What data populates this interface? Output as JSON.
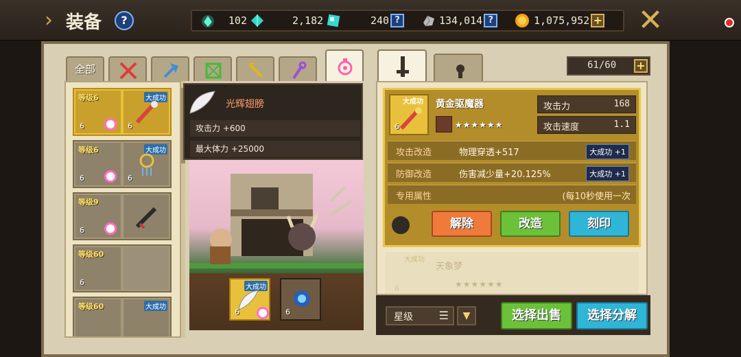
{
  "header": {
    "title": "装备",
    "help": "?",
    "resources": [
      {
        "name": "spirit-gem",
        "value": "102"
      },
      {
        "name": "crystal",
        "value": "2,182"
      },
      {
        "name": "blue-crystal",
        "value": "240",
        "badge": "?"
      },
      {
        "name": "iron-ore",
        "value": "134,014",
        "badge": "?"
      },
      {
        "name": "gold",
        "value": "1,075,952",
        "badge": "+"
      }
    ],
    "close": "✕"
  },
  "left_tabs": [
    {
      "label": "全部",
      "icon": "all"
    },
    {
      "label": "",
      "icon": "sword-icon"
    },
    {
      "label": "",
      "icon": "axe-icon"
    },
    {
      "label": "",
      "icon": "bow-icon"
    },
    {
      "label": "",
      "icon": "staff-icon"
    },
    {
      "label": "",
      "icon": "wand-icon"
    },
    {
      "label": "",
      "icon": "accessory-icon"
    }
  ],
  "equipment_list": [
    {
      "level": "等级6",
      "stars": "6",
      "tag": "大成功",
      "stars2": "6"
    },
    {
      "level": "等级6",
      "stars": "6",
      "tag": "大成功",
      "stars2": "6"
    },
    {
      "level": "等级9",
      "stars": "6",
      "tag": "",
      "stars2": ""
    },
    {
      "level": "等级60",
      "stars": "6",
      "tag": "",
      "stars2": ""
    },
    {
      "level": "等级60",
      "stars": "",
      "tag": "大成功",
      "stars2": ""
    }
  ],
  "tooltip": {
    "name": "光辉翅膀",
    "attack": "攻击力 +600",
    "hp": "最大体力 +25000"
  },
  "scene": {
    "item1_tag": "大成功",
    "item1_stars": "6",
    "item2_stars": "6"
  },
  "right": {
    "count": "61/60",
    "count_plus": "+",
    "item": {
      "tag": "大成功",
      "name": "黄金驱魔器",
      "stars": "★★★★★★",
      "star_num": "6",
      "stats": [
        {
          "label": "攻击力",
          "value": "168"
        },
        {
          "label": "攻击速度",
          "value": "1.1"
        }
      ],
      "mods": [
        {
          "label": "攻击改造",
          "value": "物理穿透+517",
          "tag": "大成功 +1"
        },
        {
          "label": "防御改造",
          "value": "伤害减少量+20.125%",
          "tag": "大成功 +1"
        },
        {
          "label": "专用属性",
          "value": "",
          "note": "(每10秒使用一次"
        }
      ],
      "buttons": {
        "unequip": "解除",
        "modify": "改造",
        "engrave": "刻印"
      }
    },
    "item2": {
      "tag": "大成功",
      "name": "天象梦",
      "stars": "★★★★★★",
      "star_num": "6"
    },
    "sort_label": "星级",
    "sell_button": "选择出售",
    "dismantle_button": "选择分解"
  },
  "colors": {
    "gold_card": "#b48d2b",
    "btn_orange": "#ef7a3c",
    "btn_green": "#6cc13a",
    "btn_cyan": "#2fb5d6"
  }
}
